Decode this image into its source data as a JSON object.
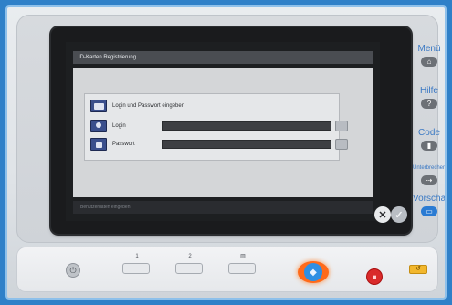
{
  "screen": {
    "title": "ID-Karten Registrierung",
    "prompt": "Login und Passwort eingeben",
    "fields": [
      {
        "label": "Login",
        "value": ""
      },
      {
        "label": "Passwort",
        "value": ""
      }
    ],
    "status_text": "Benutzerdaten eingeben",
    "cancel_symbol": "✕",
    "ok_symbol": "✓"
  },
  "side_menu": {
    "items": [
      {
        "label": "Menü",
        "key": "⌂"
      },
      {
        "label": "Hilfe",
        "key": "?"
      },
      {
        "label": "Code",
        "key": "▮"
      },
      {
        "label": "Unterbrechen",
        "key": "⇢"
      },
      {
        "label": "Vorschau",
        "key": "▭"
      }
    ]
  },
  "hard_keys": {
    "tabs": [
      "1",
      "2",
      "▥"
    ],
    "power_symbol": "⏻",
    "start_symbol": "◆",
    "stop_symbol": "■",
    "reset_symbol": "↺"
  },
  "colors": {
    "background": "#2f80c8",
    "menu_text": "#3b79c4",
    "start_button": "#ff6a1a",
    "stop_button": "#d92a2a",
    "reset_button": "#f2b72d"
  }
}
